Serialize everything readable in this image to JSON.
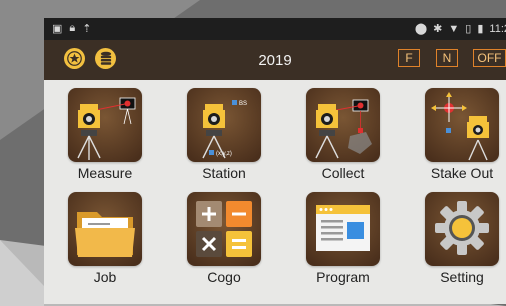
{
  "status": {
    "time": "11:2"
  },
  "appbar": {
    "title": "2019",
    "buttons": {
      "f": "F",
      "n": "N",
      "off": "OFF"
    }
  },
  "apps": [
    {
      "label": "Measure",
      "icon": "total-station-measure-icon"
    },
    {
      "label": "Station",
      "icon": "total-station-setup-icon",
      "annotation": "(x,y,z)",
      "point_label": "BS"
    },
    {
      "label": "Collect",
      "icon": "total-station-collect-icon"
    },
    {
      "label": "Stake Out",
      "icon": "total-station-stakeout-icon"
    },
    {
      "label": "Job",
      "icon": "folder-icon"
    },
    {
      "label": "Cogo",
      "icon": "calculator-icon"
    },
    {
      "label": "Program",
      "icon": "program-window-icon"
    },
    {
      "label": "Setting",
      "icon": "gear-icon"
    }
  ],
  "colors": {
    "appbar": "#3b2f25",
    "accent": "#e0822a",
    "icon_bg": "#5a3a22",
    "status_bar": "#1e1e1e"
  }
}
